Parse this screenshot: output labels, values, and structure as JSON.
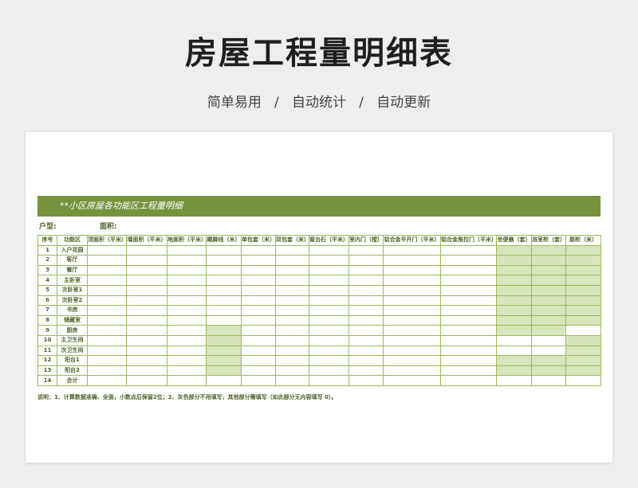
{
  "page": {
    "title": "房屋工程量明细表",
    "subtitle": "简单易用   /   自动统计   /   自动更新"
  },
  "sheet": {
    "banner": "**小区房屋各功能区工程量明细",
    "unit_type_label": "户型:",
    "area_label": "面积:",
    "columns": [
      "序号",
      "功能区",
      "顶面积（平米）",
      "墙面积（平米）",
      "地面积（平米）",
      "踢脚线（米）",
      "单包套（米）",
      "双包套（米）",
      "窗台石（平米）",
      "室内门（樘）",
      "铝合金平开门（平米）",
      "铝合金推拉门（平米）",
      "坐便器（套）",
      "浴室柜（套）",
      "厨柜（米）"
    ],
    "rows": [
      {
        "no": "1",
        "area": "入户花园"
      },
      {
        "no": "2",
        "area": "客厅"
      },
      {
        "no": "3",
        "area": "餐厅"
      },
      {
        "no": "4",
        "area": "主卧室"
      },
      {
        "no": "5",
        "area": "次卧室1"
      },
      {
        "no": "6",
        "area": "次卧室2"
      },
      {
        "no": "7",
        "area": "书房"
      },
      {
        "no": "8",
        "area": "储藏室"
      },
      {
        "no": "9",
        "area": "厨房"
      },
      {
        "no": "10",
        "area": "主卫生间"
      },
      {
        "no": "11",
        "area": "次卫生间"
      },
      {
        "no": "12",
        "area": "阳台1"
      },
      {
        "no": "13",
        "area": "阳台2"
      },
      {
        "no": "14",
        "area": "合计"
      }
    ],
    "note": "说明：1、计算数据准确、全面，小数点后保留2位；2、灰色部分不用填写，其他部分需填写（如此部分无内容填写 0）。",
    "colors": {
      "banner": "#76923c",
      "shade": "#d7e4bd",
      "text": "#4f6228"
    }
  }
}
